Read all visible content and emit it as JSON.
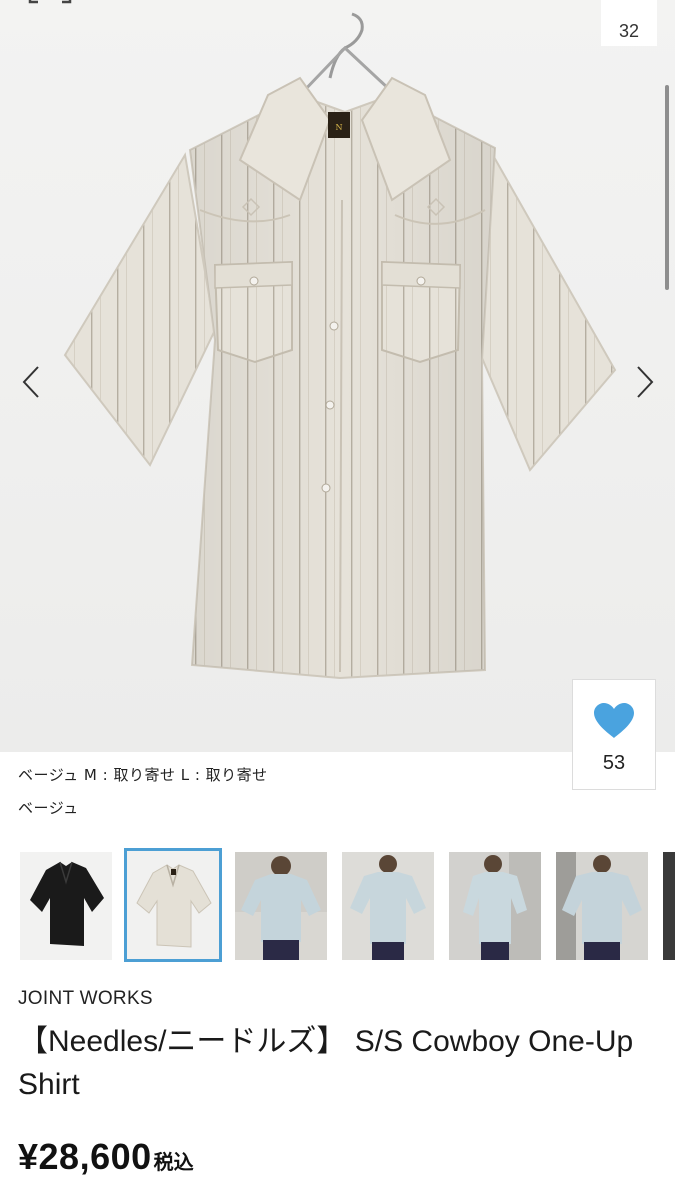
{
  "gallery": {
    "image_counter": "32",
    "prev_label": "‹",
    "next_label": "›"
  },
  "favorite": {
    "count": "53",
    "heart_color": "#4aa3df"
  },
  "stock": {
    "text": "ベージュ  M : 取り寄せ  L : 取り寄せ"
  },
  "selected_color": "ベージュ",
  "thumbnails": [
    {
      "name": "black-shirt",
      "selected": false
    },
    {
      "name": "beige-shirt",
      "selected": true
    },
    {
      "name": "model-front-1",
      "selected": false
    },
    {
      "name": "model-front-2",
      "selected": false
    },
    {
      "name": "model-side",
      "selected": false
    },
    {
      "name": "model-front-3",
      "selected": false
    }
  ],
  "product": {
    "brand": "JOINT WORKS",
    "title": "【Needles/ニードルズ】 S/S Cowboy One-Up Shirt",
    "price": "¥28,600",
    "tax_label": "税込"
  },
  "colors": {
    "accent": "#4c9fd4",
    "shirt": "#e8e4db"
  }
}
